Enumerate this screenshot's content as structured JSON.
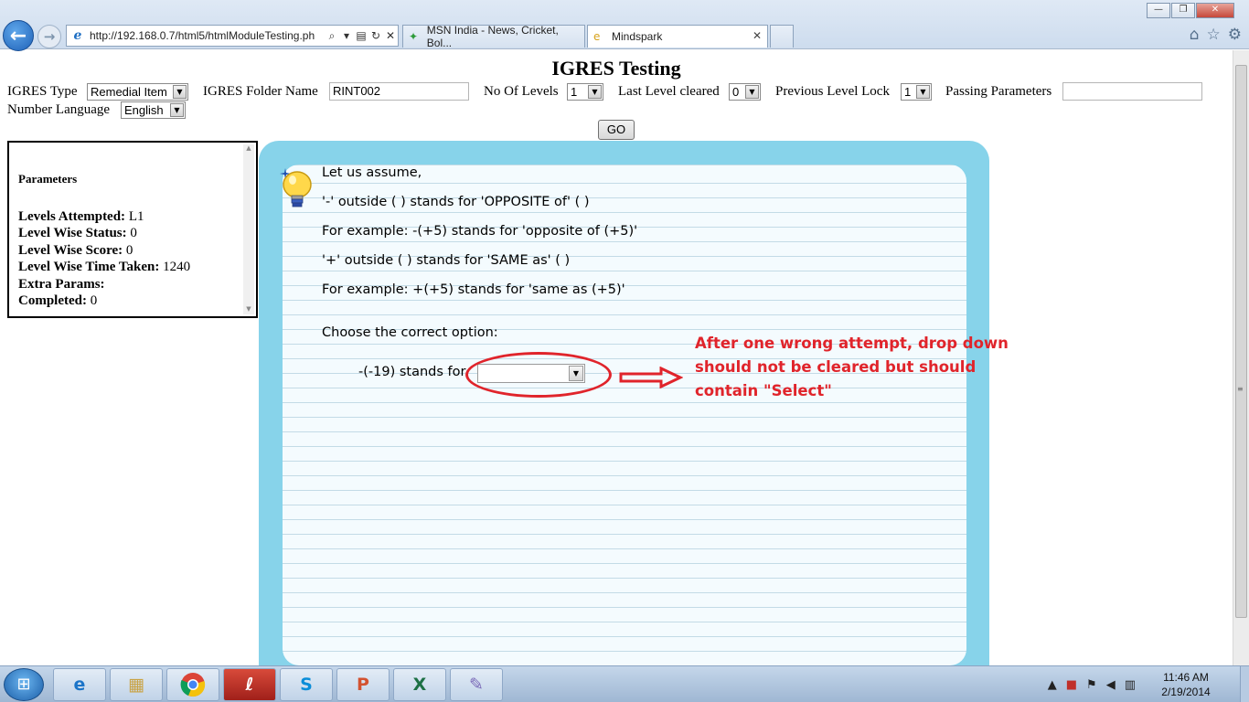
{
  "browser": {
    "address_url": "http://192.168.0.7/html5/htmlModuleTesting.ph",
    "tabs": [
      {
        "label": "MSN India - News, Cricket, Bol...",
        "icon": "msn-icon"
      },
      {
        "label": "Mindspark",
        "icon": "ie-page-icon"
      }
    ],
    "right_tools": [
      "home-icon",
      "star-icon",
      "gear-icon"
    ]
  },
  "page": {
    "title": "IGRES Testing",
    "form": {
      "igres_type_label": "IGRES Type",
      "igres_type_value": "Remedial Item",
      "folder_label": "IGRES Folder Name",
      "folder_value": "RINT002",
      "levels_label": "No Of Levels",
      "levels_value": "1",
      "last_level_label": "Last Level cleared",
      "last_level_value": "0",
      "prev_lock_label": "Previous Level Lock",
      "prev_lock_value": "1",
      "passing_label": "Passing Parameters",
      "passing_value": "",
      "number_lang_label": "Number Language",
      "number_lang_value": "English",
      "go_label": "GO"
    }
  },
  "params": {
    "heading": "Parameters",
    "rows": [
      {
        "key": "Levels Attempted:",
        "value": "L1"
      },
      {
        "key": "Level Wise Status:",
        "value": "0"
      },
      {
        "key": "Level Wise Score:",
        "value": "0"
      },
      {
        "key": "Level Wise Time Taken:",
        "value": "1240"
      },
      {
        "key": "Extra Params:",
        "value": ""
      },
      {
        "key": "Completed:",
        "value": "0"
      }
    ]
  },
  "question": {
    "lines": [
      "Let us assume,",
      "'-' outside ( ) stands for 'OPPOSITE of' ( )",
      "For example: -(+5) stands for 'opposite of (+5)'",
      "'+' outside ( ) stands for 'SAME as' ( )",
      "For example: +(+5) stands for 'same as (+5)'"
    ],
    "prompt": "Choose the correct option:",
    "item_text": "-(-19) stands for",
    "dropdown_value": ""
  },
  "annotation": {
    "color": "#e0242b",
    "lines": [
      "After one wrong attempt, drop down",
      "should not be cleared but should",
      "contain \"Select\""
    ]
  },
  "taskbar": {
    "apps": [
      "internet-explorer-icon",
      "file-explorer-icon",
      "chrome-icon",
      "app-icon",
      "skype-icon",
      "powerpoint-icon",
      "excel-icon",
      "paint-icon"
    ],
    "time": "11:46 AM",
    "date": "2/19/2014"
  }
}
